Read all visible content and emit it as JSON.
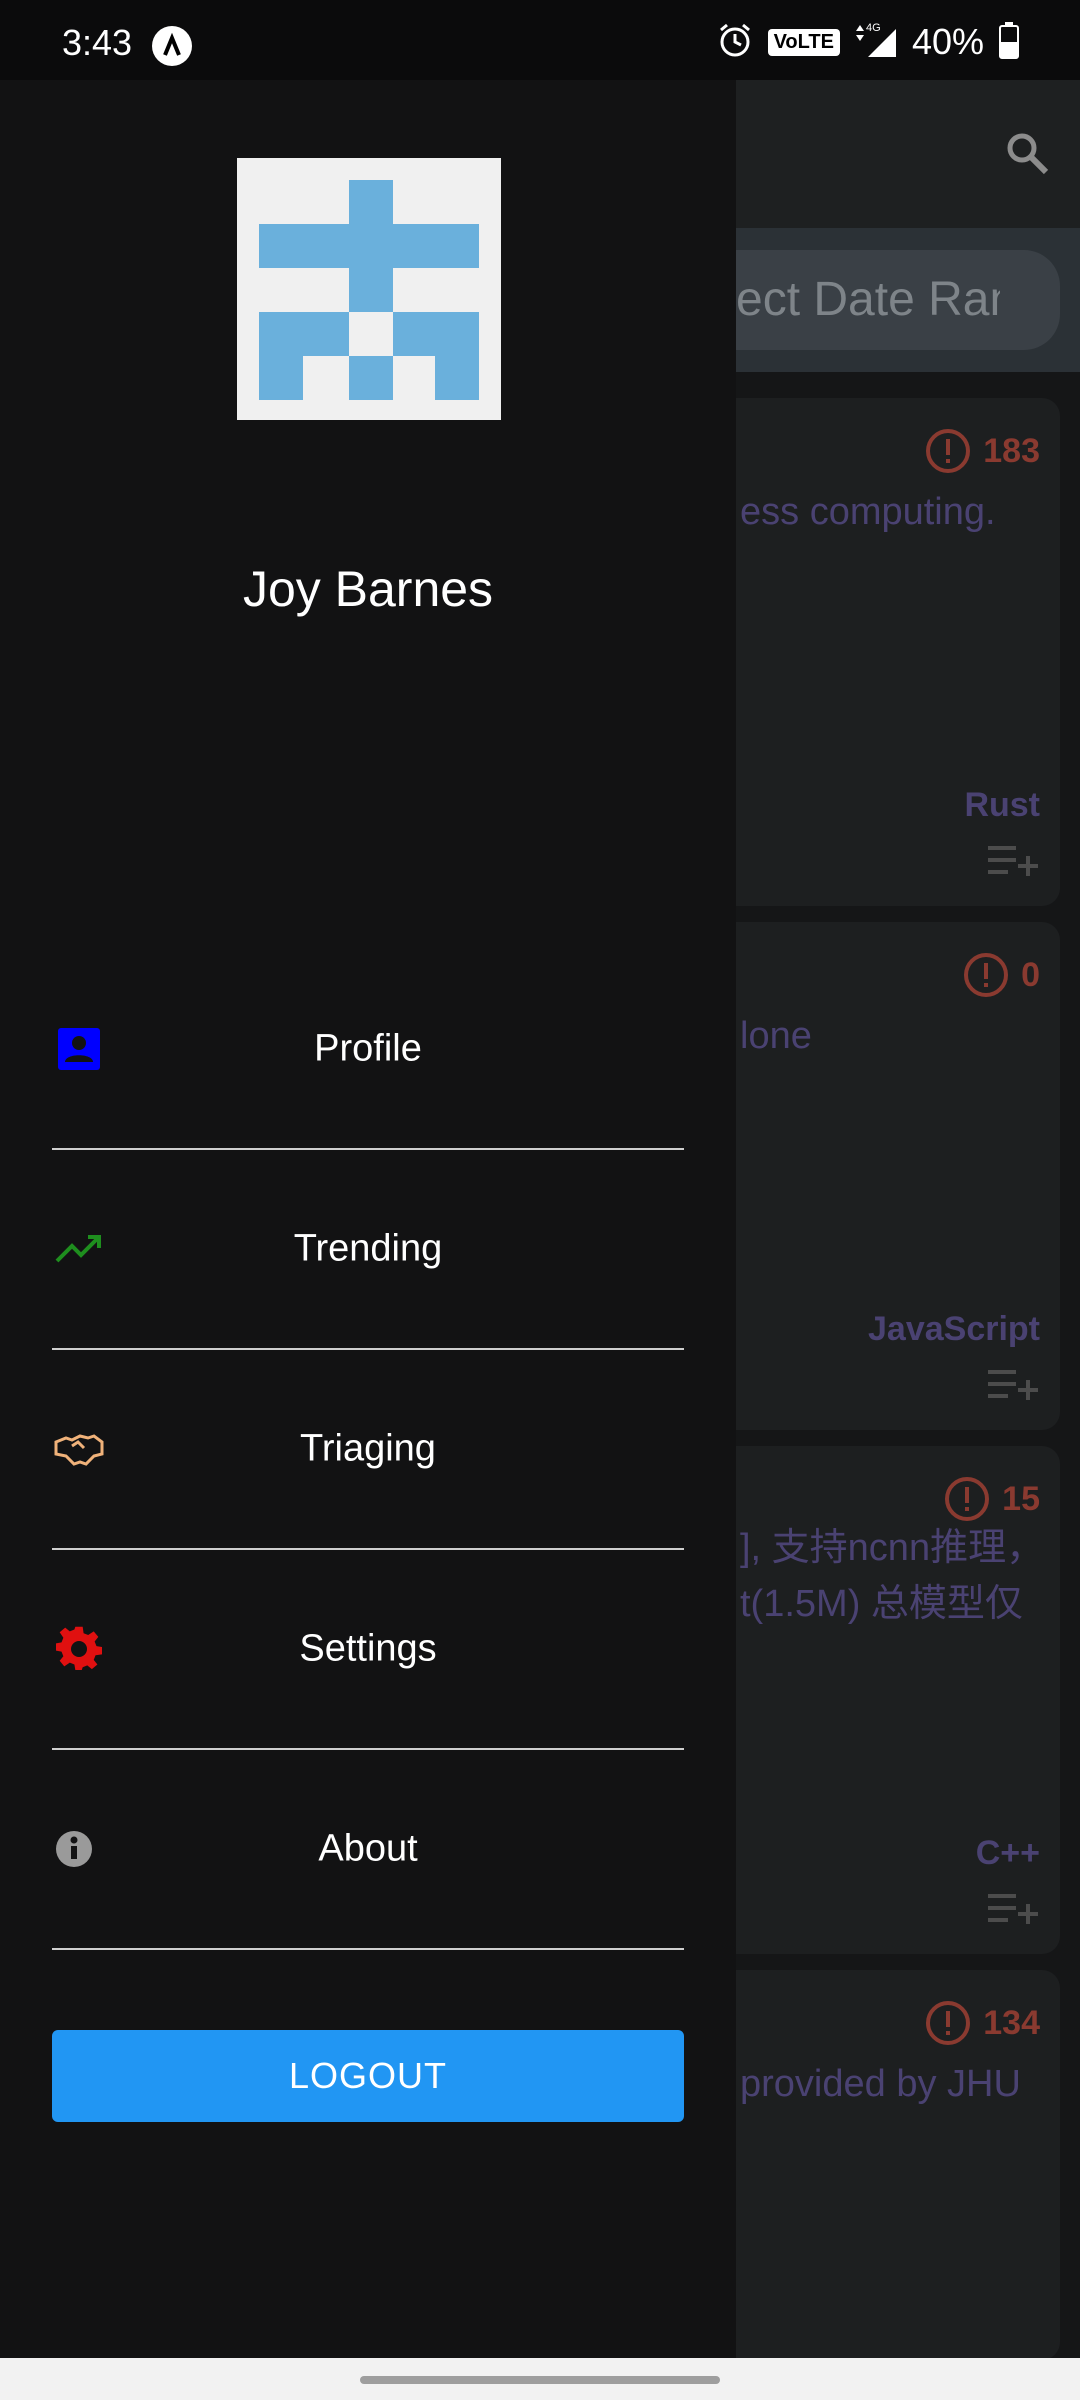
{
  "status_bar": {
    "time": "3:43",
    "volte": "VoLTE",
    "network": "4G",
    "battery": "40%"
  },
  "background": {
    "date_range_placeholder": "ect Date Ran",
    "cards": [
      {
        "issues": "183",
        "description": "ess computing.",
        "language": "Rust"
      },
      {
        "issues": "0",
        "description": "lone",
        "language": "JavaScript"
      },
      {
        "issues": "15",
        "description_line1": "], 支持ncnn推理，",
        "description_line2": "t(1.5M) 总模型仅",
        "language": "C++"
      },
      {
        "issues": "134",
        "description": "provided by JHU"
      }
    ]
  },
  "drawer": {
    "user_name": "Joy Barnes",
    "menu": [
      {
        "label": "Profile",
        "icon": "profile-icon",
        "color": "#0000ff"
      },
      {
        "label": "Trending",
        "icon": "trending-icon",
        "color": "#1e8e1e"
      },
      {
        "label": "Triaging",
        "icon": "handshake-icon",
        "color": "#f0b27a"
      },
      {
        "label": "Settings",
        "icon": "gear-icon",
        "color": "#e01010"
      },
      {
        "label": "About",
        "icon": "info-icon",
        "color": "#9a9a9a"
      }
    ],
    "logout_label": "LOGOUT"
  },
  "colors": {
    "accent": "#2196f3",
    "drawer_bg": "#121213"
  }
}
